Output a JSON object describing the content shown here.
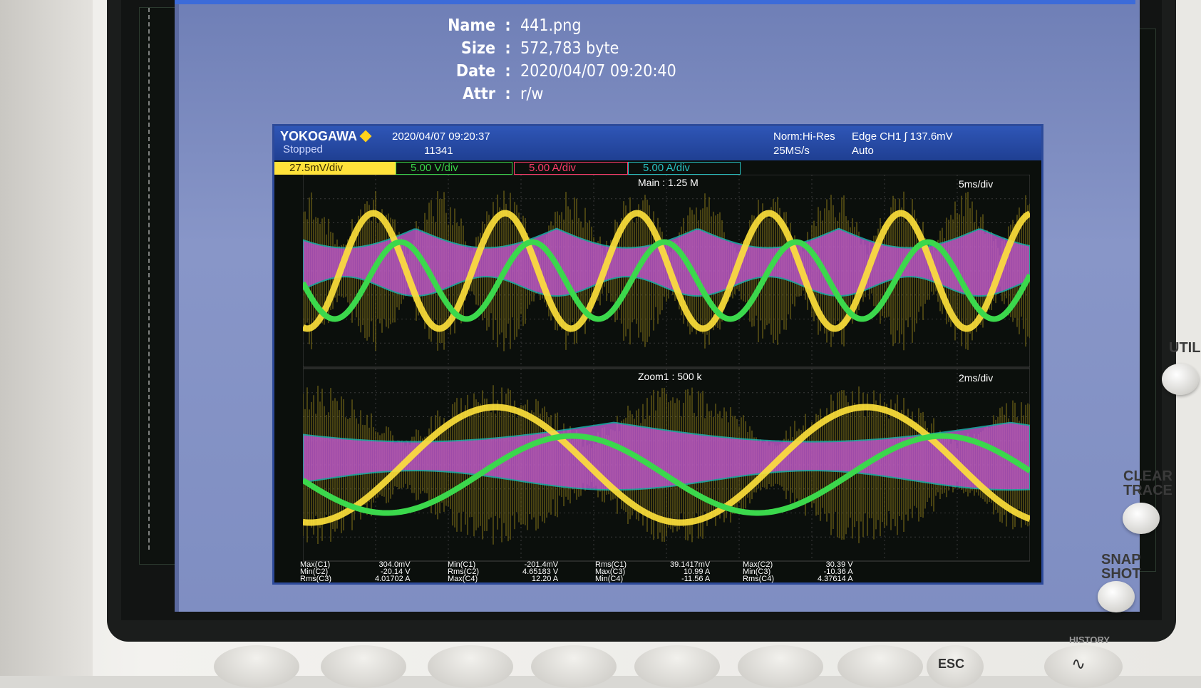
{
  "file_info": {
    "rows": [
      {
        "key": "Name",
        "value": "441.png"
      },
      {
        "key": "Size",
        "value": "572,783 byte"
      },
      {
        "key": "Date",
        "value": "2020/04/07 09:20:40"
      },
      {
        "key": "Attr",
        "value": "r/w"
      }
    ]
  },
  "scope": {
    "brand": "YOKOGAWA",
    "status": "Stopped",
    "timestamp": "2020/04/07 09:20:37",
    "count": "11341",
    "mode": "Norm:Hi-Res",
    "rate": "25MS/s",
    "trigger": "Edge CH1 ∫ 137.6mV",
    "trigger_mode": "Auto",
    "channels": [
      {
        "label": "27.5mV/div",
        "color": "#ffe23a"
      },
      {
        "label": "5.00 V/div",
        "color": "#39d44a"
      },
      {
        "label": "5.00 A/div",
        "color": "#ff3b6b"
      },
      {
        "label": "5.00 A/div",
        "color": "#28c2c2"
      }
    ],
    "main_label": "Main : 1.25 M",
    "main_timebase": "5ms/div",
    "zoom_label": "Zoom1 : 500 k",
    "zoom_timebase": "2ms/div",
    "measurements": [
      {
        "names": "Max(C1)\nMin(C2)\nRms(C3)",
        "values": "304.0mV\n-20.14 V\n4.01702 A"
      },
      {
        "names": "Min(C1)\nRms(C2)\nMax(C4)",
        "values": "-201.4mV\n4.65183 V\n12.20 A"
      },
      {
        "names": "Rms(C1)\nMax(C3)\nMin(C4)",
        "values": "39.1417mV\n10.99 A\n-11.56 A"
      },
      {
        "names": "Max(C2)\nMin(C3)\nRms(C4)",
        "values": "30.39 V\n-10.36 A\n4.37614 A"
      }
    ]
  },
  "side_labels": {
    "div_top": "div",
    "div_mid": "div"
  },
  "hardware": {
    "util": "UTIL",
    "clear_trace": "CLEAR\nTRACE",
    "snap_shot": "SNAP\nSHOT",
    "history": "HISTORY",
    "esc": "ESC"
  },
  "colors": {
    "yellow": "#ffe23a",
    "green": "#3bd84c",
    "magenta": "#c35ad0",
    "cyan": "#1fb8b8",
    "viewer_bg": "#8090c6"
  }
}
